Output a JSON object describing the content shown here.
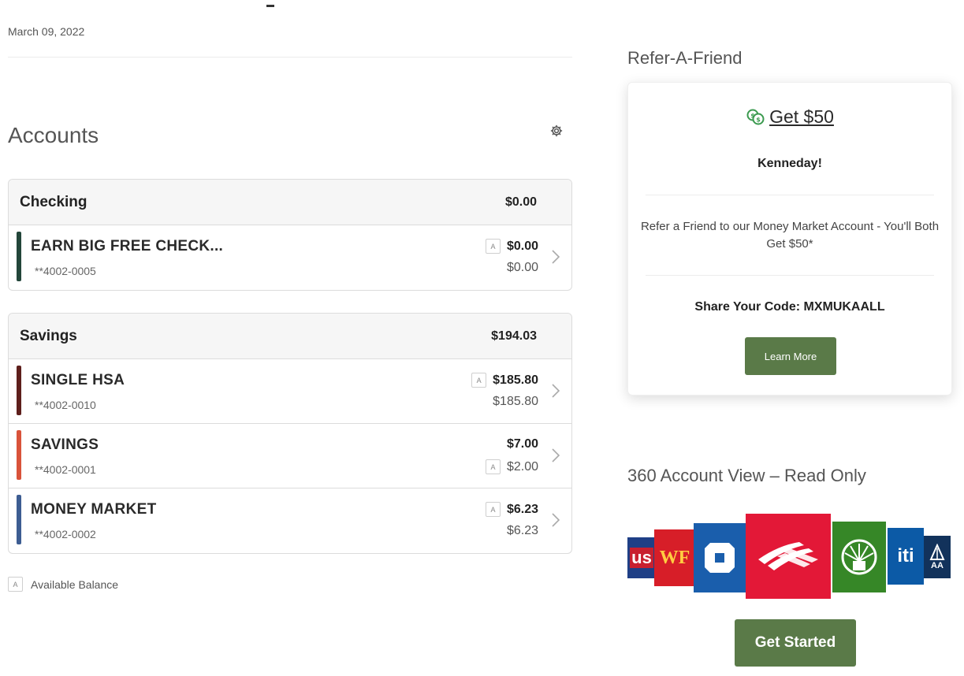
{
  "header": {
    "date": "March 09, 2022"
  },
  "accounts": {
    "title": "Accounts",
    "groups": [
      {
        "name": "Checking",
        "total": "$0.00",
        "items": [
          {
            "name": "EARN BIG FREE CHECK...",
            "number": "**4002-0005",
            "line1": "$0.00",
            "line2": "$0.00",
            "badge_on": "line1",
            "color": "#23463a"
          }
        ]
      },
      {
        "name": "Savings",
        "total": "$194.03",
        "items": [
          {
            "name": "SINGLE HSA",
            "number": "**4002-0010",
            "line1": "$185.80",
            "line2": "$185.80",
            "badge_on": "line1",
            "color": "#5e1f1c"
          },
          {
            "name": "SAVINGS",
            "number": "**4002-0001",
            "line1": "$7.00",
            "line2": "$2.00",
            "badge_on": "line2",
            "color": "#d9533a"
          },
          {
            "name": "MONEY MARKET",
            "number": "**4002-0002",
            "line1": "$6.23",
            "line2": "$6.23",
            "badge_on": "line1",
            "color": "#3d5d92"
          }
        ]
      }
    ],
    "badge_letter": "A",
    "legend": "Available Balance"
  },
  "refer": {
    "section_title": "Refer-A-Friend",
    "get_link": "Get $50",
    "name": "Kenneday!",
    "description": "Refer a Friend to our Money Market Account - You'll Both Get $50*",
    "code": "Share Your Code: MXMUKAALL",
    "button": "Learn More"
  },
  "view360": {
    "title": "360 Account View – Read Only",
    "logo_texts": {
      "usbank": "us",
      "wellsfargo": "WF",
      "citi": "iti",
      "usaa": "AA"
    },
    "button": "Get Started"
  },
  "colors": {
    "accent_green": "#5a7a48",
    "money_icon": "#3b9a4f"
  }
}
